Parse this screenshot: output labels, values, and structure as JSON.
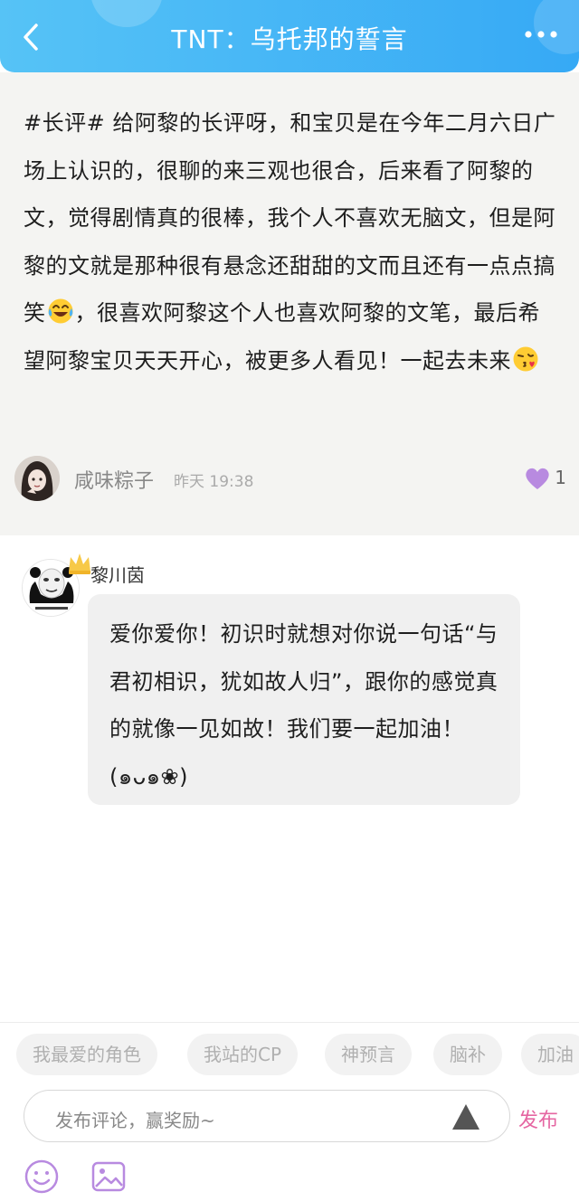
{
  "header": {
    "title": "TNT：乌托邦的誓言",
    "back_icon": "chevron-left-icon",
    "more_icon": "more-dots-icon",
    "gradient_start": "#56c3f6",
    "gradient_end": "#36a9f5"
  },
  "post": {
    "text_part1": "#长评# 给阿黎的长评呀，和宝贝是在今年二月六日广场上认识的，很聊的来三观也很合，后来看了阿黎的文，觉得剧情真的很棒，我个人不喜欢无脑文，但是阿黎的文就是那种很有悬念还甜甜的文而且还有一点点搞笑",
    "emoji1": "laughing-tears-emoji",
    "text_part2": "，很喜欢阿黎这个人也喜欢阿黎的文笔，最后希望阿黎宝贝天天开心，被更多人看见！一起去未来",
    "emoji2": "kiss-emoji",
    "author_name": "咸味粽子",
    "time": "昨天 19:38",
    "like_count": "1",
    "like_color": "#b88ae0"
  },
  "comment": {
    "name": "黎川茵",
    "text": "爱你爱你！初识时就想对你说一句话“与君初相识，犹如故人归”，跟你的感觉真的就像一见如故！我们要一起加油！(๑ᴗ๑❀)"
  },
  "bottom": {
    "tags": [
      "我最爱的角色",
      "我站的CP",
      "神预言",
      "脑补",
      "加油"
    ],
    "input_placeholder": "发布评论，赢奖励~",
    "publish_label": "发布",
    "publish_color": "#e566a2"
  }
}
